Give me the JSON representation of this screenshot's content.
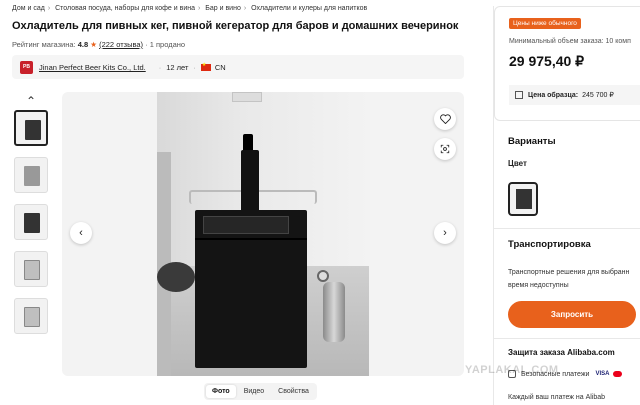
{
  "breadcrumb": [
    "Дом и сад",
    "Столовая посуда, наборы для кофе и вина",
    "Бар и вино",
    "Охладители и кулеры для напитков"
  ],
  "title": "Охладитель для пивных кег, пивной кегератор для баров и домашних вечеринок",
  "meta": {
    "rating_label": "Рейтинг магазина:",
    "rating_value": "4.8",
    "star": "★",
    "reviews": "(222 отзыва)",
    "sold": "1 продано"
  },
  "seller": {
    "name": "Jinan Perfect Beer Kits Co., Ltd.",
    "years": "12 лет",
    "country": "CN"
  },
  "gallery": {
    "thumb_count": 5,
    "nav_left": "‹",
    "nav_right": "›",
    "up_arrow": "⌃",
    "tabs": [
      "Фото",
      "Видео",
      "Свойства"
    ]
  },
  "panel": {
    "badge": "Цены ниже обычного",
    "min_order": "Минимальный объем заказа: 10 комп",
    "price": "29 975,40 ₽",
    "sample_label": "Цена образца:",
    "sample_price": "245 700 ₽",
    "variants_title": "Варианты",
    "color_label": "Цвет",
    "shipping_title": "Транспортировка",
    "shipping_text_1": "Транспортные решения для выбранн",
    "shipping_text_2": "время недоступны",
    "request_button": "Запросить",
    "protection_title": "Защита заказа Alibaba.com",
    "payments_label": "Безопасные платежи",
    "visa": "VISA",
    "payment_desc": "Каждый ваш платеж на Alibab"
  },
  "watermark": "YAPLAKAL.COM",
  "colors": {
    "accent": "#e8611c",
    "text": "#222222",
    "muted": "#555555",
    "panel_bg": "#f5f5f5"
  },
  "icons": [
    "heart-icon",
    "lens-search-icon",
    "chevron-left-icon",
    "chevron-right-icon",
    "chevron-up-icon",
    "box-icon",
    "shield-icon",
    "star-icon",
    "flag-cn-icon"
  ]
}
